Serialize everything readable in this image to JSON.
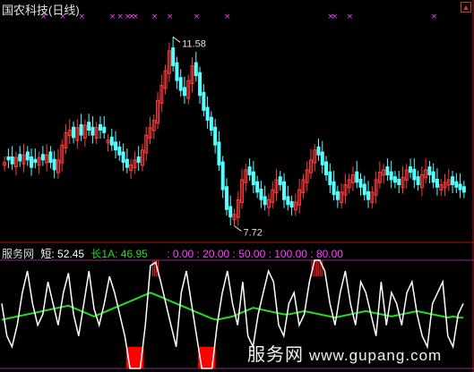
{
  "header": {
    "title": "国农科技(日线)"
  },
  "price_panel": {
    "high_label": "11.58",
    "low_label": "7.72",
    "colors": {
      "up": "#ff3b3b",
      "down": "#54ffff",
      "marker": "#ff40ff"
    }
  },
  "indicator_panel": {
    "name": "服务网",
    "short_label": "短:",
    "short_value": "52.45",
    "long_label": "长1A:",
    "long_value": "46.95",
    "levels_text": ": 0.00  : 20.00  : 50.00  : 100.00  : 80.00",
    "colors": {
      "short": "#ffffff",
      "long": "#22dd22",
      "levels": "#ff40ff",
      "signal": "#ff0000"
    }
  },
  "watermark": {
    "brand": "服务网",
    "url": "www.gupang.com"
  },
  "chart_data": [
    {
      "type": "candlestick",
      "title": "国农科技(日线)",
      "annotations": [
        {
          "text": "11.58",
          "kind": "high"
        },
        {
          "text": "7.72",
          "kind": "low"
        }
      ],
      "ylim": [
        7.5,
        11.9
      ],
      "close": [
        8.95,
        9.0,
        8.92,
        9.05,
        8.98,
        9.1,
        9.0,
        8.85,
        8.95,
        9.05,
        9.0,
        9.1,
        8.95,
        8.8,
        9.0,
        9.3,
        9.55,
        9.6,
        9.45,
        9.65,
        9.5,
        9.7,
        9.6,
        9.5,
        9.65,
        9.6,
        9.55,
        9.4,
        9.3,
        9.2,
        9.1,
        8.95,
        8.85,
        8.9,
        9.0,
        8.95,
        9.2,
        9.5,
        9.65,
        9.8,
        10.2,
        10.5,
        10.8,
        11.2,
        10.9,
        10.6,
        10.4,
        10.3,
        10.6,
        10.9,
        10.7,
        10.3,
        10.0,
        9.8,
        9.6,
        9.3,
        8.9,
        8.4,
        8.0,
        7.85,
        7.9,
        8.2,
        8.6,
        8.8,
        8.7,
        8.5,
        8.35,
        8.2,
        8.1,
        8.2,
        8.4,
        8.6,
        8.5,
        8.2,
        8.1,
        8.05,
        8.15,
        8.4,
        8.6,
        8.8,
        9.0,
        9.2,
        9.1,
        8.9,
        8.7,
        8.5,
        8.3,
        8.2,
        8.35,
        8.5,
        8.6,
        8.7,
        8.55,
        8.45,
        8.3,
        8.2,
        8.35,
        8.6,
        8.75,
        8.8,
        8.7,
        8.6,
        8.55,
        8.5,
        8.65,
        8.8,
        8.75,
        8.6,
        8.5,
        8.7,
        8.8,
        8.7,
        8.55,
        8.45,
        8.5,
        8.55,
        8.6,
        8.5,
        8.45,
        8.4,
        8.35
      ],
      "up_days": [
        0,
        3,
        5,
        9,
        11,
        14,
        15,
        16,
        17,
        19,
        21,
        24,
        27,
        33,
        34,
        36,
        37,
        38,
        39,
        40,
        41,
        42,
        43,
        48,
        49,
        60,
        61,
        62,
        63,
        69,
        70,
        71,
        76,
        77,
        78,
        79,
        80,
        81,
        88,
        89,
        90,
        91,
        96,
        97,
        98,
        99,
        104,
        105,
        109,
        110,
        114,
        115,
        116
      ]
    },
    {
      "type": "line",
      "series": [
        {
          "name": "短",
          "values": [
            60,
            30,
            20,
            40,
            70,
            90,
            60,
            40,
            50,
            80,
            60,
            40,
            70,
            88,
            50,
            30,
            60,
            90,
            55,
            40,
            60,
            85,
            70,
            50,
            30,
            0,
            0,
            0,
            40,
            95,
            98,
            80,
            60,
            40,
            20,
            70,
            90,
            60,
            30,
            0,
            0,
            0,
            40,
            70,
            90,
            60,
            40,
            80,
            30,
            20,
            50,
            70,
            90,
            80,
            40,
            30,
            60,
            70,
            40,
            50,
            80,
            100,
            100,
            90,
            60,
            40,
            70,
            90,
            60,
            40,
            80,
            70,
            50,
            30,
            80,
            40,
            70,
            60,
            40,
            70,
            80,
            50,
            30,
            20,
            60,
            70,
            80,
            30,
            20,
            50,
            60
          ],
          "last": 52.45
        },
        {
          "name": "长1A",
          "values": [
            45,
            46,
            47,
            48,
            49,
            50,
            51,
            52,
            53,
            54,
            55,
            56,
            57,
            58,
            56,
            54,
            52,
            50,
            48,
            50,
            52,
            54,
            56,
            58,
            60,
            62,
            64,
            66,
            68,
            70,
            68,
            66,
            64,
            62,
            60,
            58,
            56,
            54,
            52,
            50,
            48,
            46,
            45,
            46,
            47,
            48,
            50,
            52,
            54,
            56,
            55,
            54,
            53,
            52,
            51,
            50,
            50,
            51,
            52,
            53,
            52,
            51,
            50,
            49,
            48,
            47,
            48,
            49,
            50,
            51,
            52,
            53,
            52,
            51,
            50,
            49,
            48,
            49,
            50,
            51,
            52,
            53,
            52,
            51,
            50,
            49,
            48,
            47,
            48,
            47,
            46.95
          ],
          "last": 46.95
        }
      ],
      "levels": [
        0,
        20,
        50,
        80,
        100
      ]
    }
  ]
}
